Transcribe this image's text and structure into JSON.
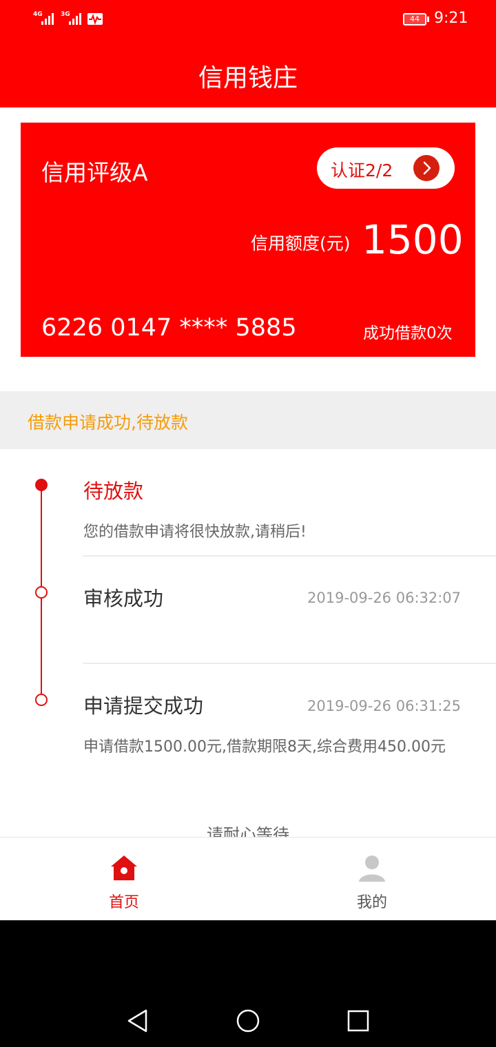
{
  "status_bar": {
    "signal_1_label": "4G",
    "signal_2_label": "3G",
    "battery": "44",
    "time": "9:21"
  },
  "header": {
    "title": "信用钱庄"
  },
  "card": {
    "rating": "信用评级A",
    "cert_button": "认证2/2",
    "quota_label": "信用额度(元)",
    "quota_value": "1500",
    "card_number": "6226 0147 **** 5885",
    "loan_count": "成功借款0次"
  },
  "status_message": "借款申请成功,待放款",
  "timeline": [
    {
      "title": "待放款",
      "desc": "您的借款申请将很快放款,请稍后!",
      "time": "",
      "state": "active"
    },
    {
      "title": "审核成功",
      "desc": "",
      "time": "2019-09-26 06:32:07",
      "state": "done"
    },
    {
      "title": "申请提交成功",
      "desc": "申请借款1500.00元,借款期限8天,综合费用450.00元",
      "time": "2019-09-26 06:31:25",
      "state": "done"
    }
  ],
  "footer_note": "请耐心等待",
  "bottom_nav": [
    {
      "label": "首页",
      "icon": "home-icon",
      "active": true
    },
    {
      "label": "我的",
      "icon": "user-icon",
      "active": false
    }
  ],
  "colors": {
    "brand_red": "#fe0000",
    "accent_red": "#e01010",
    "status_orange": "#f59c0b"
  }
}
